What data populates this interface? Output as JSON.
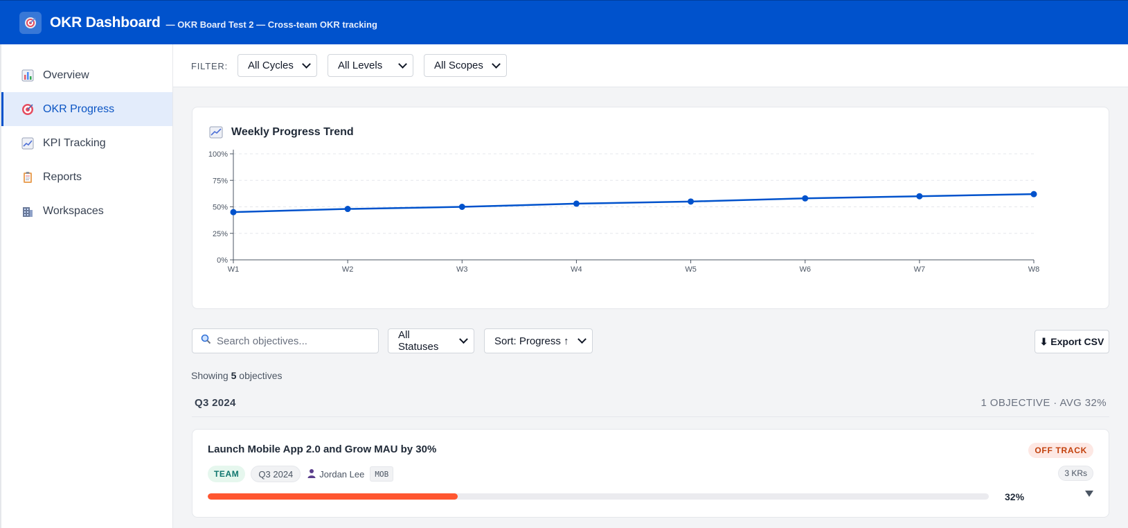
{
  "header": {
    "title": "OKR Dashboard",
    "subtitle": "— OKR Board Test 2 — Cross-team OKR tracking",
    "logo_icon": "target-icon",
    "bg_color": "#0052cc"
  },
  "sidebar": {
    "items": [
      {
        "label": "Overview",
        "icon": "bar-chart-icon",
        "active": false
      },
      {
        "label": "OKR Progress",
        "icon": "target-icon",
        "active": true
      },
      {
        "label": "KPI Tracking",
        "icon": "line-chart-icon",
        "active": false
      },
      {
        "label": "Reports",
        "icon": "clipboard-icon",
        "active": false
      },
      {
        "label": "Workspaces",
        "icon": "building-icon",
        "active": false
      }
    ]
  },
  "filters": {
    "label": "FILTER:",
    "cycle": "All Cycles",
    "level": "All Levels",
    "scope": "All Scopes"
  },
  "chart_title": "Weekly Progress Trend",
  "chart_data": {
    "type": "line",
    "title": "Weekly Progress Trend",
    "xlabel": "",
    "ylabel": "",
    "categories": [
      "W1",
      "W2",
      "W3",
      "W4",
      "W5",
      "W6",
      "W7",
      "W8"
    ],
    "series": [
      {
        "values": [
          45,
          48,
          50,
          53,
          55,
          58,
          60,
          62
        ]
      }
    ],
    "ylim": [
      0,
      100
    ],
    "yticks": [
      "0%",
      "25%",
      "50%",
      "75%",
      "100%"
    ],
    "grid": true,
    "line_color": "#0052cc"
  },
  "toolbar": {
    "search_placeholder": "Search objectives...",
    "status": "All Statuses",
    "sort": "Sort: Progress ↑",
    "export_label": "⬇ Export CSV"
  },
  "summary": {
    "prefix": "Showing",
    "count": "5",
    "suffix": "objectives"
  },
  "group": {
    "title": "Q3 2024",
    "meta": "1 OBJECTIVE · AVG 32%"
  },
  "objective": {
    "title": "Launch Mobile App 2.0 and Grow MAU by 30%",
    "status": "OFF TRACK",
    "level": "TEAM",
    "cycle": "Q3 2024",
    "owner": "Jordan Lee",
    "scope_code": "MOB",
    "kr_count": "3 KRs",
    "progress": 32,
    "progress_label": "32%",
    "progress_color": "#ff5630"
  }
}
